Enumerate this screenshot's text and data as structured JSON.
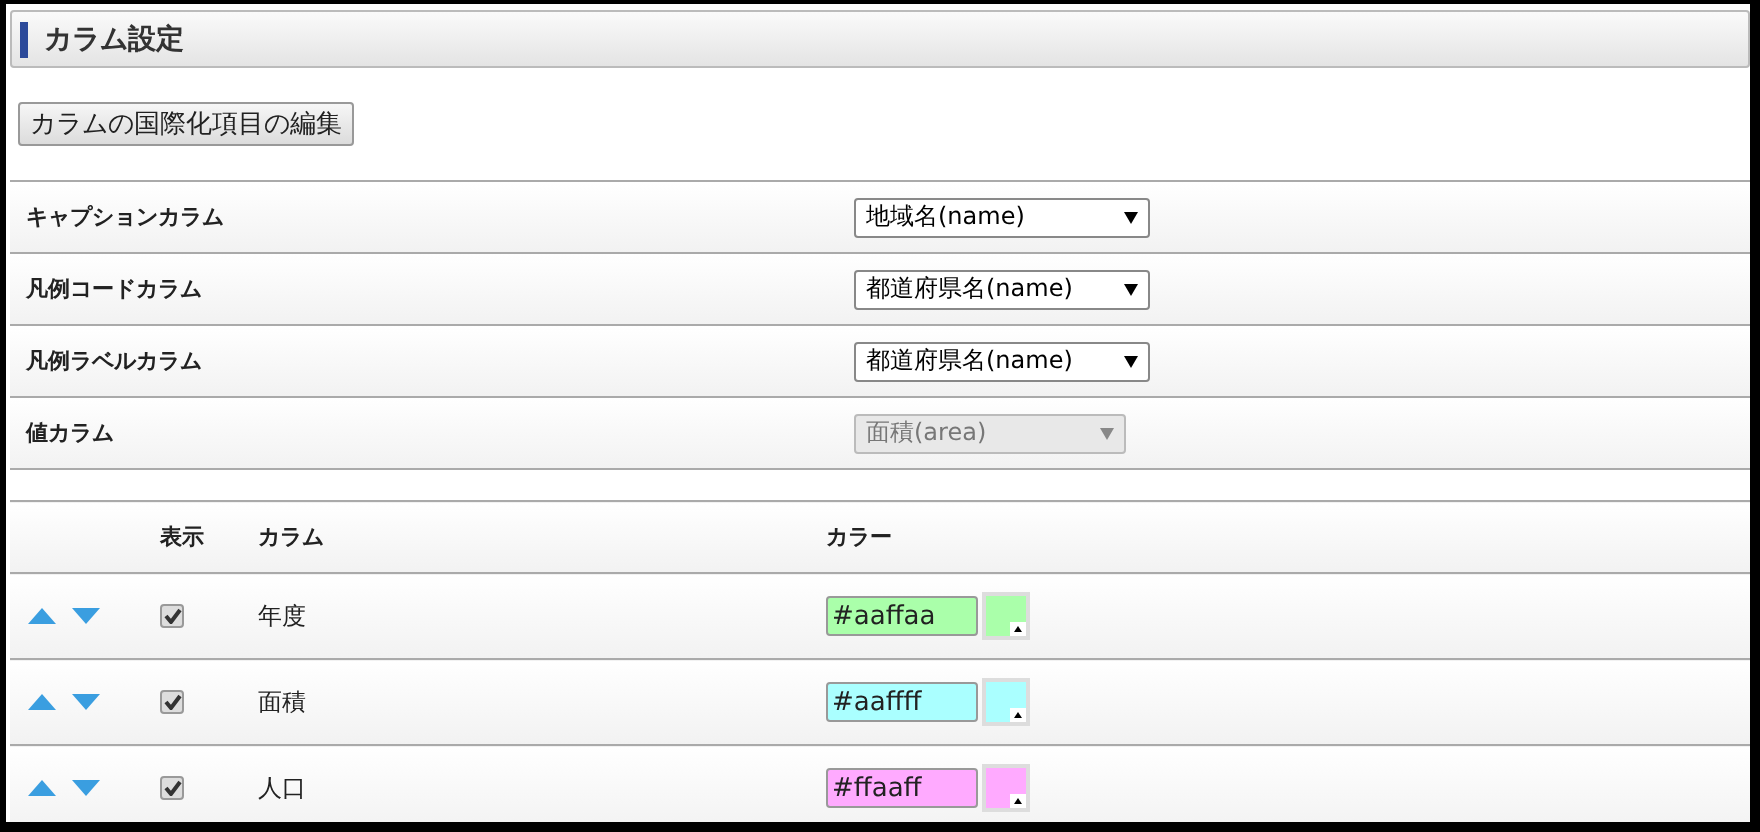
{
  "panel": {
    "title": "カラム設定"
  },
  "i18n_button": "カラムの国際化項目の編集",
  "settings": [
    {
      "label": "キャプションカラム",
      "value": "地域名(name)",
      "disabled": false
    },
    {
      "label": "凡例コードカラム",
      "value": "都道府県名(name)",
      "disabled": false
    },
    {
      "label": "凡例ラベルカラム",
      "value": "都道府県名(name)",
      "disabled": false
    },
    {
      "label": "値カラム",
      "value": "面積(area)",
      "disabled": true
    }
  ],
  "table": {
    "columns": [
      "表示",
      "カラム",
      "カラー"
    ],
    "rows": [
      {
        "visible": true,
        "name": "年度",
        "color": "#aaffaa"
      },
      {
        "visible": true,
        "name": "面積",
        "color": "#aaffff"
      },
      {
        "visible": true,
        "name": "人口",
        "color": "#ffaaff"
      }
    ]
  }
}
